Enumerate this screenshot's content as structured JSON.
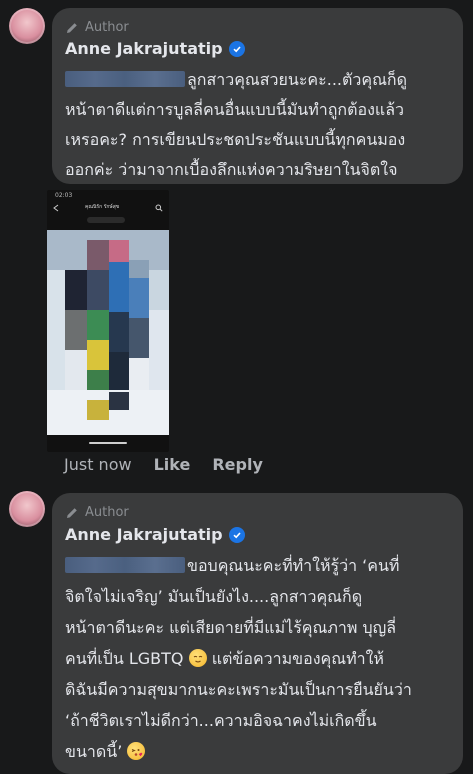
{
  "comments": [
    {
      "badge": "Author",
      "name": "Anne Jakrajutatip",
      "lines": [
        "ลูกสาวคุณสวยนะคะ...ตัวคุณก็ดู",
        "หน้าตาดีแต่การบูลลี่คนอื่นแบบนี้มันทำถูกต้องแล้ว",
        "เหรอคะ? การเขียนประชดประชันแบบนี้ทุกคนมอง",
        "ออกค่ะ ว่ามาจากเบื้องลึกแห่งความริษยาในจิตใจ"
      ],
      "attachment": {
        "status_time": "02:03",
        "header_title": "คุณนิรัก รักษ์สุข"
      },
      "timestamp": "Just now",
      "like_label": "Like",
      "reply_label": "Reply"
    },
    {
      "badge": "Author",
      "name": "Anne Jakrajutatip",
      "lines": [
        "ขอบคุณนะคะที่ทำให้รู้ว่า ‘คนที่",
        "จิตใจไม่เจริญ’ มันเป็นยังไง....ลูกสาวคุณก็ดู",
        "หน้าตาดีนะคะ แต่เสียดายที่มีแม่ไร้คุณภาพ บุญลี่",
        "คนที่เป็น LGBTQ",
        "แต่ข้อความของคุณทำให้",
        "ดิฉันมีความสุขมากนะคะเพราะมันเป็นการยืนยันว่า",
        "‘ถ้าชีวิตเราไม่ดีกว่า...ความอิจฉาคงไม่เกิดขึ้น",
        "ขนาดนี้’"
      ]
    }
  ],
  "icons": [
    "pencil-icon",
    "verified-badge-icon",
    "relieved-face-emoji",
    "kissing-face-emoji",
    "search-icon",
    "back-arrow-icon"
  ],
  "colors": {
    "background": "#18191a",
    "bubble": "#3a3b3c",
    "verified": "#1b74e4",
    "muted": "#b0b3b8"
  }
}
